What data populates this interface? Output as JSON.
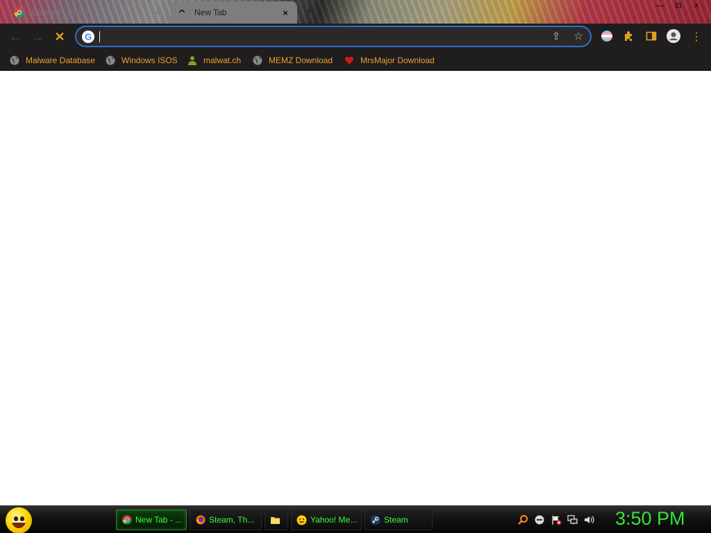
{
  "window": {
    "tabs": [
      {
        "title": "Discord | Chat",
        "close": "×",
        "active": false
      },
      {
        "title": "New Tab",
        "close": "×",
        "active": true
      }
    ],
    "new_tab_glyph": "+",
    "controls": {
      "minimize": "—",
      "maximize": "⧉",
      "close": "×"
    }
  },
  "toolbar": {
    "back_glyph": "←",
    "forward_glyph": "→",
    "stop_glyph": "✕",
    "omnibox": {
      "value": "",
      "placeholder": ""
    },
    "share_glyph": "⇪",
    "star_glyph": "☆",
    "menu_glyph": "⋮"
  },
  "bookmarks": [
    {
      "label": "Malware Database",
      "icon": "globe-icon"
    },
    {
      "label": "Windows ISOS",
      "icon": "globe-icon"
    },
    {
      "label": "malwat.ch",
      "icon": "person-icon"
    },
    {
      "label": "MEMZ Download",
      "icon": "globe-icon"
    },
    {
      "label": "MrsMajor Download",
      "icon": "heart-icon"
    }
  ],
  "taskbar": {
    "items": [
      {
        "label": "New Tab - ...",
        "icon": "chrome-icon",
        "active": true
      },
      {
        "label": "Steam, Th...",
        "icon": "firefox-icon",
        "active": false
      },
      {
        "label": "",
        "icon": "folder-icon",
        "active": false
      },
      {
        "label": "Yahoo! Me...",
        "icon": "yahoo-messenger-icon",
        "active": false
      },
      {
        "label": "Steam",
        "icon": "steam-icon",
        "active": false
      }
    ],
    "clock": "3:50 PM"
  },
  "colors": {
    "bookmark_text": "#f0a030",
    "taskbar_text": "#39ff39",
    "omnibox_border": "#2d6fd0",
    "toolbar_bg": "#1f1d1d"
  }
}
